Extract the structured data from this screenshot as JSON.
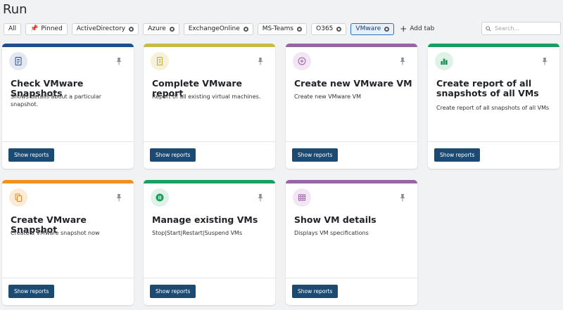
{
  "page": {
    "title": "Run"
  },
  "tabs": [
    {
      "label": "All",
      "closable": false,
      "active": false
    },
    {
      "label": "Pinned",
      "closable": false,
      "active": false,
      "pinned": true
    },
    {
      "label": "ActiveDirectory",
      "closable": true,
      "active": false
    },
    {
      "label": "Azure",
      "closable": true,
      "active": false
    },
    {
      "label": "ExchangeOnline",
      "closable": true,
      "active": false
    },
    {
      "label": "MS-Teams",
      "closable": true,
      "active": false
    },
    {
      "label": "O365",
      "closable": true,
      "active": false
    },
    {
      "label": "VMware",
      "closable": true,
      "active": true
    }
  ],
  "add_tab_label": "Add tab",
  "search": {
    "placeholder": "Search..."
  },
  "cards": [
    {
      "title": "Check VMware Snapshots",
      "description": "Shows details about a particular snapshot.",
      "accent": "#1f4e8f",
      "icon_bg": "#e3e8f2",
      "icon_color": "#2b4f86",
      "icon": "report-list-icon",
      "button": "Show reports"
    },
    {
      "title": "Complete VMware report",
      "description": "Report of all existing virtual machines.",
      "accent": "#c9bc45",
      "icon_bg": "#f6f1d8",
      "icon_color": "#b9a93b",
      "icon": "document-icon",
      "button": "Show reports"
    },
    {
      "title": "Create new VMware VM",
      "description": "Create new VMware VM",
      "accent": "#9a63a6",
      "icon_bg": "#f3e6f4",
      "icon_color": "#9a5ea8",
      "icon": "plus-circle-icon",
      "button": "Show reports"
    },
    {
      "title": "Create report of all snapshots of all VMs",
      "description": "Create report of all snapshots of all VMs",
      "accent": "#17a060",
      "icon_bg": "#dff2e7",
      "icon_color": "#1b8a55",
      "icon": "bar-chart-icon",
      "button": "Show reports"
    },
    {
      "title": "Create VMware Snapshot",
      "description": "Create a VMware snapshot now",
      "accent": "#f0901e",
      "icon_bg": "#fcebd6",
      "icon_color": "#e0862a",
      "icon": "copy-icon",
      "button": "Show reports"
    },
    {
      "title": "Manage existing VMs",
      "description": "Stop|Start|Restart|Suspend VMs",
      "accent": "#17a060",
      "icon_bg": "#dff2e7",
      "icon_color": "#1aa05c",
      "icon": "pause-icon",
      "button": "Show reports"
    },
    {
      "title": "Show VM details",
      "description": "Displays VM specifications",
      "accent": "#9a63a6",
      "icon_bg": "#f3e6f4",
      "icon_color": "#9a5ea8",
      "icon": "table-icon",
      "button": "Show reports"
    }
  ]
}
